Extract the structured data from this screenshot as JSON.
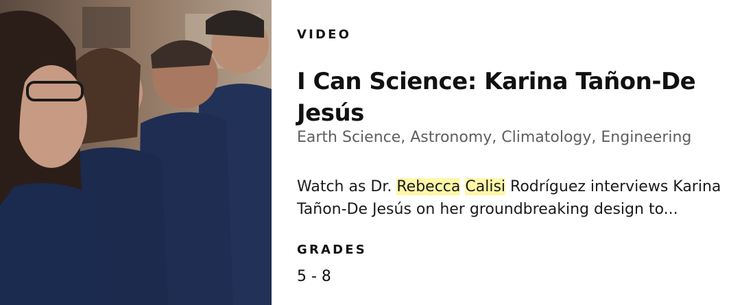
{
  "card": {
    "image_alt": "Students in navy polo shirts looking upward",
    "eyebrow": "VIDEO",
    "title": "I Can Science: Karina Tañon-De Jesús",
    "subjects": "Earth Science, Astronomy, Climatology, Engineering",
    "description": {
      "before": "Watch as Dr. ",
      "highlight_1": "Rebecca",
      "space": " ",
      "highlight_2": "Calisi",
      "after": " Rodríguez interviews Karina Tañon-De Jesús on her groundbreaking design to..."
    },
    "grades_label": "GRADES",
    "grades_value": "5 - 8"
  },
  "colors": {
    "highlight": "#fff7a8",
    "shirt": "#1d2c4e",
    "subjects_text": "#5e5e5e"
  }
}
